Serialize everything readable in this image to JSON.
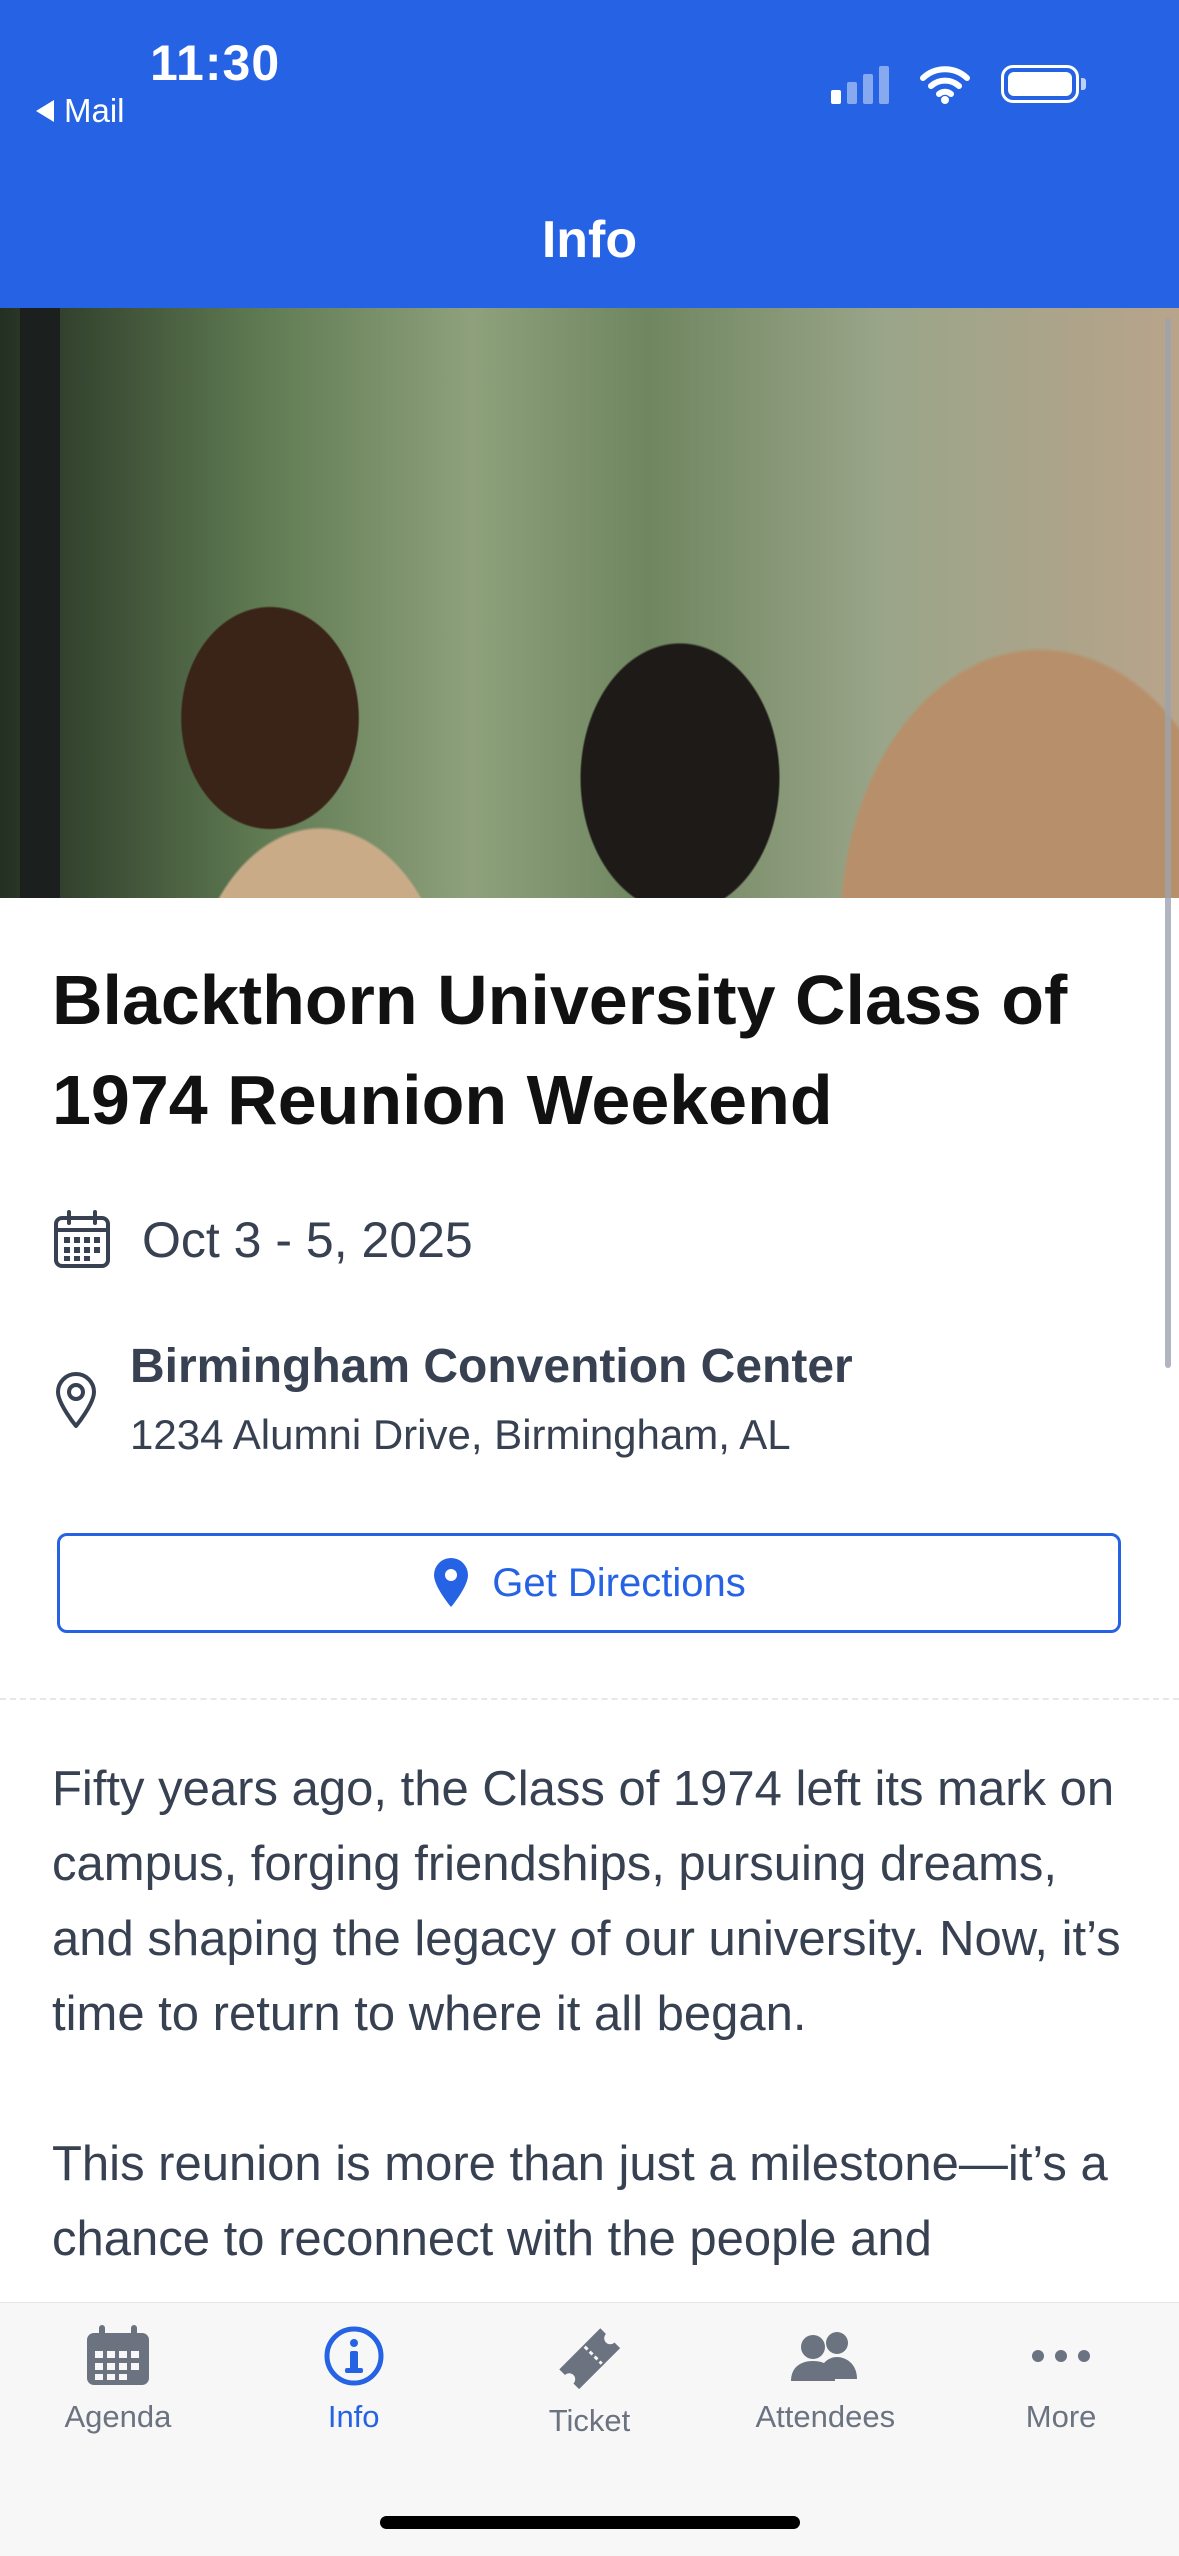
{
  "status_bar": {
    "time": "11:30",
    "back_label": "Mail"
  },
  "header": {
    "title": "Info"
  },
  "event": {
    "title": "Blackthorn University Class of 1974 Reunion Weekend",
    "date": "Oct 3 - 5, 2025",
    "venue": "Birmingham Convention Center",
    "address": "1234 Alumni Drive, Birmingham, AL",
    "directions_label": "Get Directions"
  },
  "description": [
    "Fifty years ago, the Class of 1974 left its mark on campus, forging friendships, pursuing dreams, and shaping the legacy of our university. Now, it’s time to return to where it all began.",
    "This reunion is more than just a milestone—it’s a chance to reconnect with the people and"
  ],
  "tabs": [
    {
      "label": "Agenda",
      "icon": "calendar-icon",
      "active": false
    },
    {
      "label": "Info",
      "icon": "info-icon",
      "active": true
    },
    {
      "label": "Ticket",
      "icon": "ticket-icon",
      "active": false
    },
    {
      "label": "Attendees",
      "icon": "people-icon",
      "active": false
    },
    {
      "label": "More",
      "icon": "more-icon",
      "active": false
    }
  ],
  "colors": {
    "brand": "#2563e4",
    "text": "#374151",
    "inactive": "#6b7280"
  }
}
